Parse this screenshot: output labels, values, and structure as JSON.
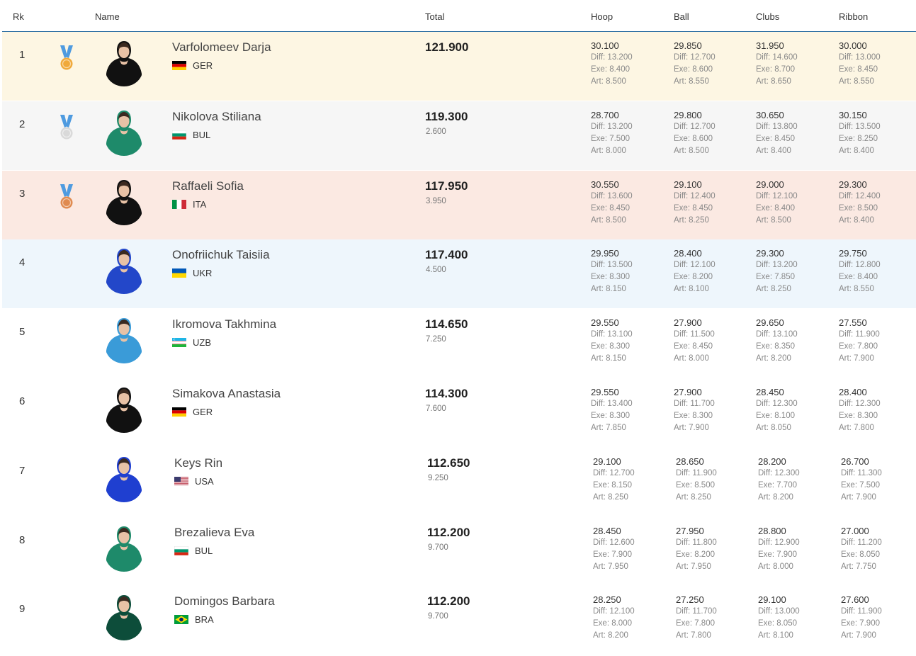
{
  "header": {
    "rk": "Rk",
    "name": "Name",
    "total": "Total",
    "hoop": "Hoop",
    "ball": "Ball",
    "clubs": "Clubs",
    "ribbon": "Ribbon"
  },
  "colors": {
    "row1": "#fdf6e3",
    "row2": "#f6f6f6",
    "row3": "#fbe9e2",
    "row4": "#eef6fc",
    "header_rule": "#2e6fa3",
    "ribbon_blue": "#4f9be0",
    "gold": "#f0a93a",
    "silver": "#d9d9d9",
    "bronze": "#e08a4f"
  },
  "rows": [
    {
      "rank": "1",
      "medal": "gold",
      "name": "Varfolomeev Darja",
      "country": "GER",
      "flag": "germany-flag",
      "total": "121.900",
      "gap": "",
      "hoop": {
        "score": "30.100",
        "diff": "Diff: 13.200",
        "exe": "Exe: 8.400",
        "art": "Art: 8.500"
      },
      "ball": {
        "score": "29.850",
        "diff": "Diff: 12.700",
        "exe": "Exe: 8.600",
        "art": "Art: 8.550"
      },
      "clubs": {
        "score": "31.950",
        "diff": "Diff: 14.600",
        "exe": "Exe: 8.700",
        "art": "Art: 8.650"
      },
      "ribbon": {
        "score": "30.000",
        "diff": "Diff: 13.000",
        "exe": "Exe: 8.450",
        "art": "Art: 8.550"
      }
    },
    {
      "rank": "2",
      "medal": "silver",
      "name": "Nikolova Stiliana",
      "country": "BUL",
      "flag": "bulgaria-flag",
      "total": "119.300",
      "gap": "2.600",
      "hoop": {
        "score": "28.700",
        "diff": "Diff: 13.200",
        "exe": "Exe: 7.500",
        "art": "Art: 8.000"
      },
      "ball": {
        "score": "29.800",
        "diff": "Diff: 12.700",
        "exe": "Exe: 8.600",
        "art": "Art: 8.500"
      },
      "clubs": {
        "score": "30.650",
        "diff": "Diff: 13.800",
        "exe": "Exe: 8.450",
        "art": "Art: 8.400"
      },
      "ribbon": {
        "score": "30.150",
        "diff": "Diff: 13.500",
        "exe": "Exe: 8.250",
        "art": "Art: 8.400"
      }
    },
    {
      "rank": "3",
      "medal": "bronze",
      "name": "Raffaeli Sofia",
      "country": "ITA",
      "flag": "italy-flag",
      "total": "117.950",
      "gap": "3.950",
      "hoop": {
        "score": "30.550",
        "diff": "Diff: 13.600",
        "exe": "Exe: 8.450",
        "art": "Art: 8.500"
      },
      "ball": {
        "score": "29.100",
        "diff": "Diff: 12.400",
        "exe": "Exe: 8.450",
        "art": "Art: 8.250"
      },
      "clubs": {
        "score": "29.000",
        "diff": "Diff: 12.100",
        "exe": "Exe: 8.400",
        "art": "Art: 8.500"
      },
      "ribbon": {
        "score": "29.300",
        "diff": "Diff: 12.400",
        "exe": "Exe: 8.500",
        "art": "Art: 8.400"
      }
    },
    {
      "rank": "4",
      "medal": "",
      "name": "Onofriichuk Taisiia",
      "country": "UKR",
      "flag": "ukraine-flag",
      "total": "117.400",
      "gap": "4.500",
      "hoop": {
        "score": "29.950",
        "diff": "Diff: 13.500",
        "exe": "Exe: 8.300",
        "art": "Art: 8.150"
      },
      "ball": {
        "score": "28.400",
        "diff": "Diff: 12.100",
        "exe": "Exe: 8.200",
        "art": "Art: 8.100"
      },
      "clubs": {
        "score": "29.300",
        "diff": "Diff: 13.200",
        "exe": "Exe: 7.850",
        "art": "Art: 8.250"
      },
      "ribbon": {
        "score": "29.750",
        "diff": "Diff: 12.800",
        "exe": "Exe: 8.400",
        "art": "Art: 8.550"
      }
    },
    {
      "rank": "5",
      "medal": "",
      "name": "Ikromova Takhmina",
      "country": "UZB",
      "flag": "uzbekistan-flag",
      "total": "114.650",
      "gap": "7.250",
      "hoop": {
        "score": "29.550",
        "diff": "Diff: 13.100",
        "exe": "Exe: 8.300",
        "art": "Art: 8.150"
      },
      "ball": {
        "score": "27.900",
        "diff": "Diff: 11.500",
        "exe": "Exe: 8.450",
        "art": "Art: 8.000"
      },
      "clubs": {
        "score": "29.650",
        "diff": "Diff: 13.100",
        "exe": "Exe: 8.350",
        "art": "Art: 8.200"
      },
      "ribbon": {
        "score": "27.550",
        "diff": "Diff: 11.900",
        "exe": "Exe: 7.800",
        "art": "Art: 7.900"
      }
    },
    {
      "rank": "6",
      "medal": "",
      "name": "Simakova Anastasia",
      "country": "GER",
      "flag": "germany-flag",
      "total": "114.300",
      "gap": "7.600",
      "hoop": {
        "score": "29.550",
        "diff": "Diff: 13.400",
        "exe": "Exe: 8.300",
        "art": "Art: 7.850"
      },
      "ball": {
        "score": "27.900",
        "diff": "Diff: 11.700",
        "exe": "Exe: 8.300",
        "art": "Art: 7.900"
      },
      "clubs": {
        "score": "28.450",
        "diff": "Diff: 12.300",
        "exe": "Exe: 8.100",
        "art": "Art: 8.050"
      },
      "ribbon": {
        "score": "28.400",
        "diff": "Diff: 12.300",
        "exe": "Exe: 8.300",
        "art": "Art: 7.800"
      }
    },
    {
      "rank": "7",
      "medal": "",
      "name": "Keys Rin",
      "country": "USA",
      "flag": "usa-flag",
      "total": "112.650",
      "gap": "9.250",
      "hoop": {
        "score": "29.100",
        "diff": "Diff: 12.700",
        "exe": "Exe: 8.150",
        "art": "Art: 8.250"
      },
      "ball": {
        "score": "28.650",
        "diff": "Diff: 11.900",
        "exe": "Exe: 8.500",
        "art": "Art: 8.250"
      },
      "clubs": {
        "score": "28.200",
        "diff": "Diff: 12.300",
        "exe": "Exe: 7.700",
        "art": "Art: 8.200"
      },
      "ribbon": {
        "score": "26.700",
        "diff": "Diff: 11.300",
        "exe": "Exe: 7.500",
        "art": "Art: 7.900"
      }
    },
    {
      "rank": "8",
      "medal": "",
      "name": "Brezalieva Eva",
      "country": "BUL",
      "flag": "bulgaria-flag",
      "total": "112.200",
      "gap": "9.700",
      "hoop": {
        "score": "28.450",
        "diff": "Diff: 12.600",
        "exe": "Exe: 7.900",
        "art": "Art: 7.950"
      },
      "ball": {
        "score": "27.950",
        "diff": "Diff: 11.800",
        "exe": "Exe: 8.200",
        "art": "Art: 7.950"
      },
      "clubs": {
        "score": "28.800",
        "diff": "Diff: 12.900",
        "exe": "Exe: 7.900",
        "art": "Art: 8.000"
      },
      "ribbon": {
        "score": "27.000",
        "diff": "Diff: 11.200",
        "exe": "Exe: 8.050",
        "art": "Art: 7.750"
      }
    },
    {
      "rank": "9",
      "medal": "",
      "name": "Domingos Barbara",
      "country": "BRA",
      "flag": "brazil-flag",
      "total": "112.200",
      "gap": "9.700",
      "hoop": {
        "score": "28.250",
        "diff": "Diff: 12.100",
        "exe": "Exe: 8.000",
        "art": "Art: 8.200"
      },
      "ball": {
        "score": "27.250",
        "diff": "Diff: 11.700",
        "exe": "Exe: 7.800",
        "art": "Art: 7.800"
      },
      "clubs": {
        "score": "29.100",
        "diff": "Diff: 13.000",
        "exe": "Exe: 8.050",
        "art": "Art: 8.100"
      },
      "ribbon": {
        "score": "27.600",
        "diff": "Diff: 11.900",
        "exe": "Exe: 7.900",
        "art": "Art: 7.900"
      }
    }
  ]
}
